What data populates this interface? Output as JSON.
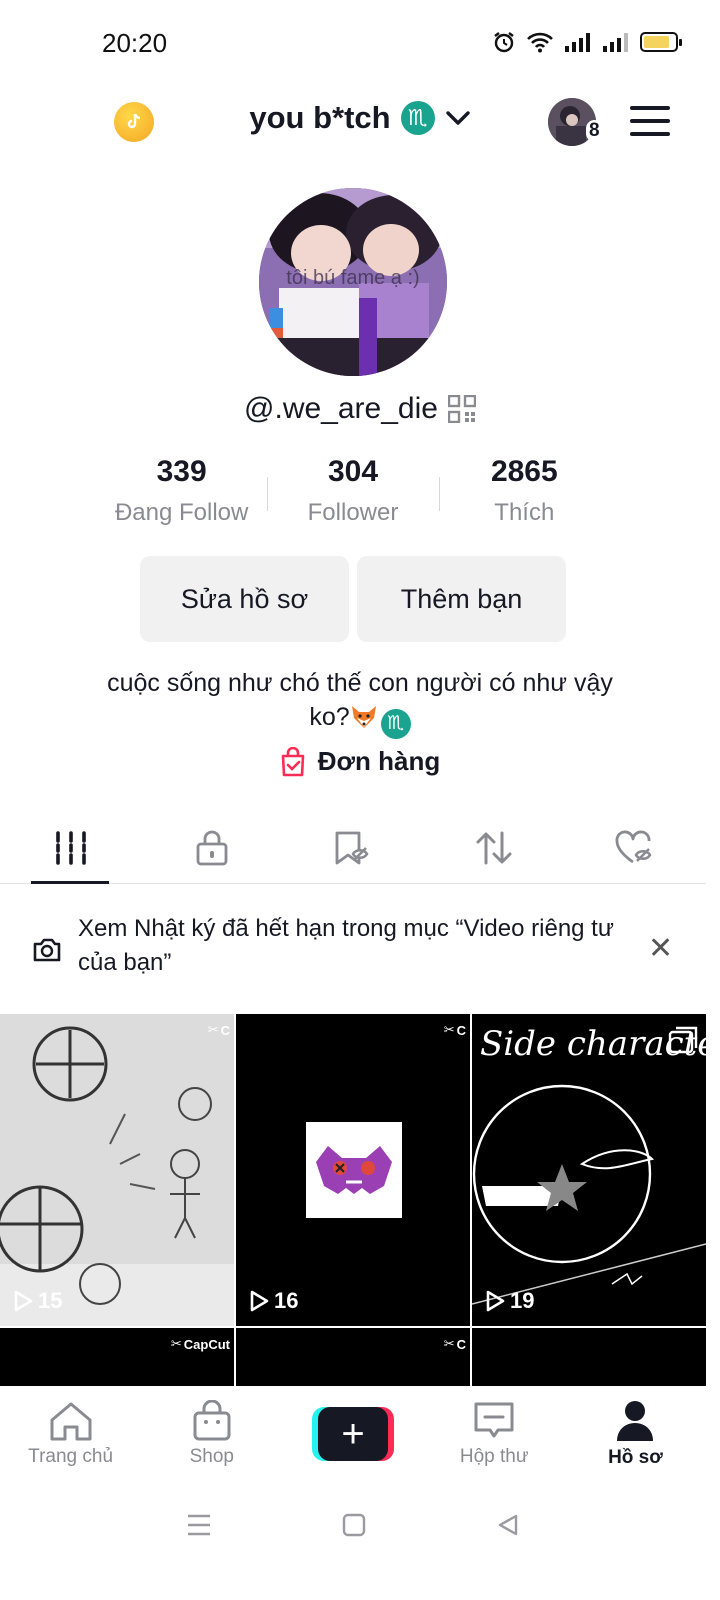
{
  "status_bar": {
    "time": "20:20"
  },
  "header": {
    "title": "you b*tch",
    "zodiac": "♏",
    "inbox_badge": "8"
  },
  "profile": {
    "handle": "@.we_are_die",
    "avatar_text": "tôi bú fame ạ :)"
  },
  "stats": [
    {
      "value": "339",
      "label": "Đang Follow"
    },
    {
      "value": "304",
      "label": "Follower"
    },
    {
      "value": "2865",
      "label": "Thích"
    }
  ],
  "buttons": {
    "edit": "Sửa hồ sơ",
    "add_friends": "Thêm bạn"
  },
  "bio": {
    "line1": "cuộc sống như chó thế con người có như vậy",
    "line2": "ko?",
    "zodiac": "♏"
  },
  "orders_label": "Đơn hàng",
  "notice": {
    "text": "Xem Nhật ký đã hết hạn trong mục “Video riêng tư của bạn”"
  },
  "videos": [
    {
      "views": "15",
      "capcut": "C"
    },
    {
      "views": "16",
      "capcut": "C"
    },
    {
      "views": "19",
      "title": "Side character"
    },
    {
      "capcut": "CapCut"
    },
    {
      "capcut": "C"
    },
    {}
  ],
  "nav": {
    "home": "Trang chủ",
    "shop": "Shop",
    "inbox": "Hộp thư",
    "profile": "Hồ sơ"
  },
  "colors": {
    "accent_red": "#fe2c55",
    "accent_cyan": "#25f4ee",
    "zodiac_teal": "#1aa38f",
    "coin": "#f5a623"
  }
}
